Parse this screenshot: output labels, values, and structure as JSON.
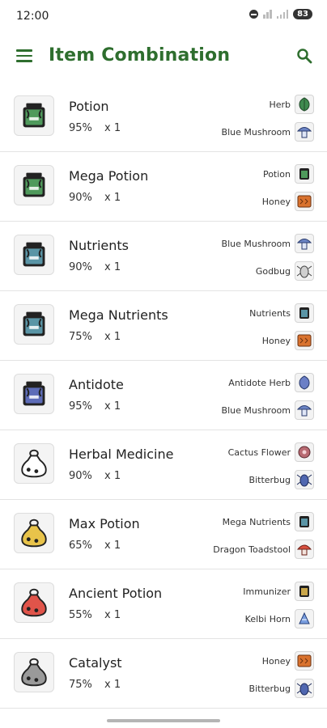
{
  "status_bar": {
    "time": "12:00",
    "battery": "83"
  },
  "app_bar": {
    "title": "Item Combination",
    "menu_icon": "menu-icon",
    "search_icon": "search-icon"
  },
  "colors": {
    "primary": "#2e6e2e",
    "herb": "#3f8a4f",
    "mushroom": "#6b84c4",
    "honey": "#d9722e",
    "godbug": "#8a8a8a",
    "antidote_herb": "#6b7fc6",
    "cactus": "#b86a72",
    "bitterbug": "#5067b0",
    "toadstool": "#d9503f",
    "immunizer": "#c9a64a",
    "kelbi": "#7a9fe0"
  },
  "items": [
    {
      "name": "Potion",
      "rate": "95%",
      "qty": "x 1",
      "icon": "jar",
      "color": "#4f9a5c",
      "ingredients": [
        {
          "name": "Herb",
          "icon": "herb"
        },
        {
          "name": "Blue Mushroom",
          "icon": "mushroom"
        }
      ]
    },
    {
      "name": "Mega Potion",
      "rate": "90%",
      "qty": "x 1",
      "icon": "jar",
      "color": "#4f9a5c",
      "ingredients": [
        {
          "name": "Potion",
          "icon": "potion"
        },
        {
          "name": "Honey",
          "icon": "honey"
        }
      ]
    },
    {
      "name": "Nutrients",
      "rate": "90%",
      "qty": "x 1",
      "icon": "jar",
      "color": "#5a95a6",
      "ingredients": [
        {
          "name": "Blue Mushroom",
          "icon": "mushroom"
        },
        {
          "name": "Godbug",
          "icon": "bug"
        }
      ]
    },
    {
      "name": "Mega Nutrients",
      "rate": "75%",
      "qty": "x 1",
      "icon": "jar",
      "color": "#5a95a6",
      "ingredients": [
        {
          "name": "Nutrients",
          "icon": "nutrients"
        },
        {
          "name": "Honey",
          "icon": "honey"
        }
      ]
    },
    {
      "name": "Antidote",
      "rate": "95%",
      "qty": "x 1",
      "icon": "jar",
      "color": "#5d6cb8",
      "ingredients": [
        {
          "name": "Antidote Herb",
          "icon": "antidote_herb"
        },
        {
          "name": "Blue Mushroom",
          "icon": "mushroom"
        }
      ]
    },
    {
      "name": "Herbal Medicine",
      "rate": "90%",
      "qty": "x 1",
      "icon": "sack",
      "color": "#ffffff",
      "ingredients": [
        {
          "name": "Cactus Flower",
          "icon": "cactus"
        },
        {
          "name": "Bitterbug",
          "icon": "bitterbug"
        }
      ]
    },
    {
      "name": "Max Potion",
      "rate": "65%",
      "qty": "x 1",
      "icon": "sack",
      "color": "#e8c34a",
      "ingredients": [
        {
          "name": "Mega Nutrients",
          "icon": "nutrients"
        },
        {
          "name": "Dragon Toadstool",
          "icon": "toadstool"
        }
      ]
    },
    {
      "name": "Ancient Potion",
      "rate": "55%",
      "qty": "x 1",
      "icon": "sack",
      "color": "#e0544a",
      "ingredients": [
        {
          "name": "Immunizer",
          "icon": "immunizer"
        },
        {
          "name": "Kelbi Horn",
          "icon": "kelbi"
        }
      ]
    },
    {
      "name": "Catalyst",
      "rate": "75%",
      "qty": "x 1",
      "icon": "sack",
      "color": "#9a9a9a",
      "ingredients": [
        {
          "name": "Honey",
          "icon": "honey"
        },
        {
          "name": "Bitterbug",
          "icon": "bitterbug"
        }
      ]
    }
  ]
}
